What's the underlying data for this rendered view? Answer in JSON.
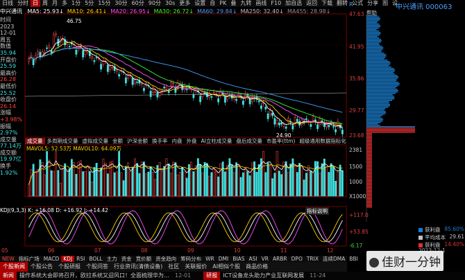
{
  "toolbar": {
    "items": [
      "日线",
      "分时",
      "日",
      "周",
      "月",
      "多",
      "1分",
      "5分",
      "15分",
      "30分",
      "60分",
      "90分",
      "30s",
      "更多",
      "设置",
      "自",
      "PK",
      "叠",
      "九转",
      "画线",
      "F10",
      "加自选",
      "返回",
      "下载",
      "翻转",
      "公式",
      "分享",
      "图",
      "设"
    ],
    "selected_index": 2
  },
  "stock": {
    "name": "中兴通讯",
    "code": "000063",
    "period": "日线"
  },
  "ma": [
    {
      "label": "MA5: 25.93↓",
      "color": "#ffffff"
    },
    {
      "label": "MA10: 26.41↓",
      "color": "#ffd400"
    },
    {
      "label": "MA20: 26.95↓",
      "color": "#ff50ff"
    },
    {
      "label": "MA30: 26.72↓",
      "color": "#30ff30"
    },
    {
      "label": "MA60: 29.84↓",
      "color": "#40a0ff"
    },
    {
      "label": "MA250: 32.40↓",
      "color": "#c0c0c0"
    },
    {
      "label": "MA455: 28.98↓",
      "color": "#909090"
    }
  ],
  "info": [
    {
      "label": "时间",
      "value": "2023"
    },
    {
      "label": "",
      "value": "12-01"
    },
    {
      "label": "周五",
      "value": ""
    },
    {
      "label": "数值",
      "value": "35.94"
    },
    {
      "label": "开盘价",
      "value": "25.59"
    },
    {
      "label": "最高价",
      "value": "26.28"
    },
    {
      "label": "最低价",
      "value": "25.52"
    },
    {
      "label": "收盘价",
      "value": "26.14"
    },
    {
      "label": "涨幅",
      "value": "+3.98%"
    },
    {
      "label": "振幅",
      "value": "2.97%"
    },
    {
      "label": "成交量",
      "value": "77.14万"
    },
    {
      "label": "成交额",
      "value": "19.97亿"
    },
    {
      "label": "换手",
      "value": "1.92%"
    }
  ],
  "price_axis": [
    "47.63",
    "41.95",
    "35.86",
    "29.77",
    "23.68"
  ],
  "annotations": {
    "high": "46.75",
    "low": "24.90"
  },
  "volume": {
    "header": "MAVOL5: 52.53万  MAVOL10: 64.09万",
    "axis": [
      "2381",
      "1500",
      "1000",
      "X1000"
    ]
  },
  "kdj": {
    "header": "KDJ(9,3,3)  K: +16.08  D: +16.92  J: +14.42",
    "axis": [
      "+117.0",
      "+53.85",
      "-6.17"
    ],
    "button": "指标说明"
  },
  "x_axis": [
    "05",
    "06",
    "07",
    "08",
    "09",
    "10",
    "11",
    "12"
  ],
  "sub_tabs": [
    "成交量",
    "多周期成交量",
    "虚拟成交量",
    "金额",
    "沪深金额",
    "换手率",
    "内盘",
    "外盘",
    "AI立柱成交量",
    "盘后成交量",
    "市盈率(ttm)",
    "超级通用数据指标化"
  ],
  "indicator_tabs": [
    "NEW",
    "指标广场",
    "MACD",
    "KDJ",
    "RSI",
    "BOLL",
    "主力",
    "资金",
    "竞价额",
    "资金趋向",
    "筹码分布",
    "WR",
    "DMI",
    "BIAS",
    "ASI",
    "VR",
    "ARBR",
    "DPO",
    "TRIX",
    "连续DMA",
    "BBI"
  ],
  "indicator_selected": 3,
  "news_tabs": [
    "个股新闻",
    "个股公告",
    "个股研报",
    "个股问答",
    "行业资讯(清债设备)",
    "社区",
    "关联报价",
    "AI相似个股",
    "商品价格"
  ],
  "news": [
    {
      "tag": "新闻",
      "text": "操作系统大会即将召开，欧拉系统又迎风口！全面梳理华为…",
      "date": "12-01"
    },
    {
      "tag": "研报",
      "text": "ICT设备龙头助力产业互联网发展",
      "date": "11-24"
    }
  ],
  "right_panel": {
    "title": "中兴通讯  000063",
    "label_r": "R",
    "label_help": "帮助",
    "chip_legend": [
      {
        "label": "获利盘",
        "value": "85.60%",
        "color": "#1a7fd0"
      },
      {
        "label": "平均成本",
        "value": "29.61",
        "color": "#c0c0c0"
      },
      {
        "label": "获利盘",
        "value": "14.40%",
        "color": "#e03030"
      }
    ],
    "date": "2023-12-1",
    "avg_cost_label": "平均成本"
  },
  "watermark": "佳财一分钟",
  "colors": {
    "up": "#ff4040",
    "down": "#40e0e0",
    "accent": "#a00000",
    "blue": "#4aa0ff"
  }
}
